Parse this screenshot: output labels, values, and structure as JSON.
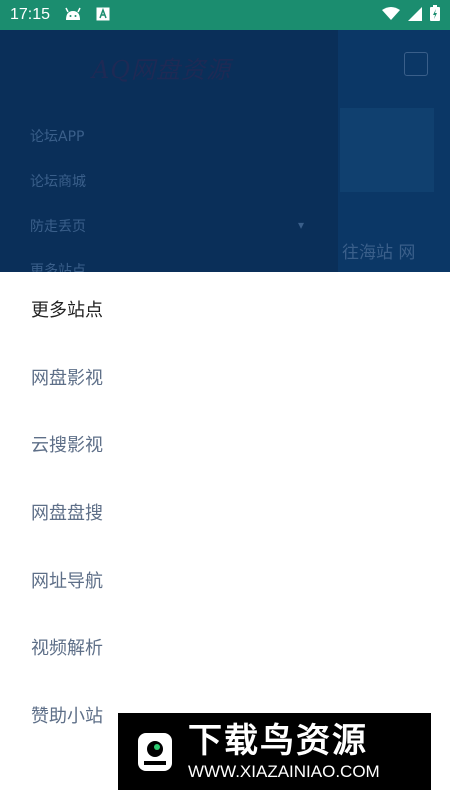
{
  "statusbar": {
    "time": "17:15",
    "icons": [
      "android-icon",
      "a-notification-icon",
      "wifi-icon",
      "signal-icon",
      "battery-icon"
    ]
  },
  "background_app": {
    "logo_text": "AQ网盘资源",
    "drawer_items": [
      "论坛APP",
      "论坛商城",
      "防走丢页",
      "更多站点"
    ],
    "right_text": "往海站 网"
  },
  "sheet": {
    "header": "更多站点",
    "items": [
      "网盘影视",
      "云搜影视",
      "网盘盘搜",
      "网址导航",
      "视频解析",
      "赞助小站"
    ]
  },
  "watermark": {
    "title": "下载鸟资源",
    "url": "WWW.XIAZAINIAO.COM"
  },
  "colors": {
    "statusbar": "#1b8d6f",
    "overlay": "#0b3766",
    "sheet_text": "#5e6f88",
    "header_text": "#222222"
  }
}
